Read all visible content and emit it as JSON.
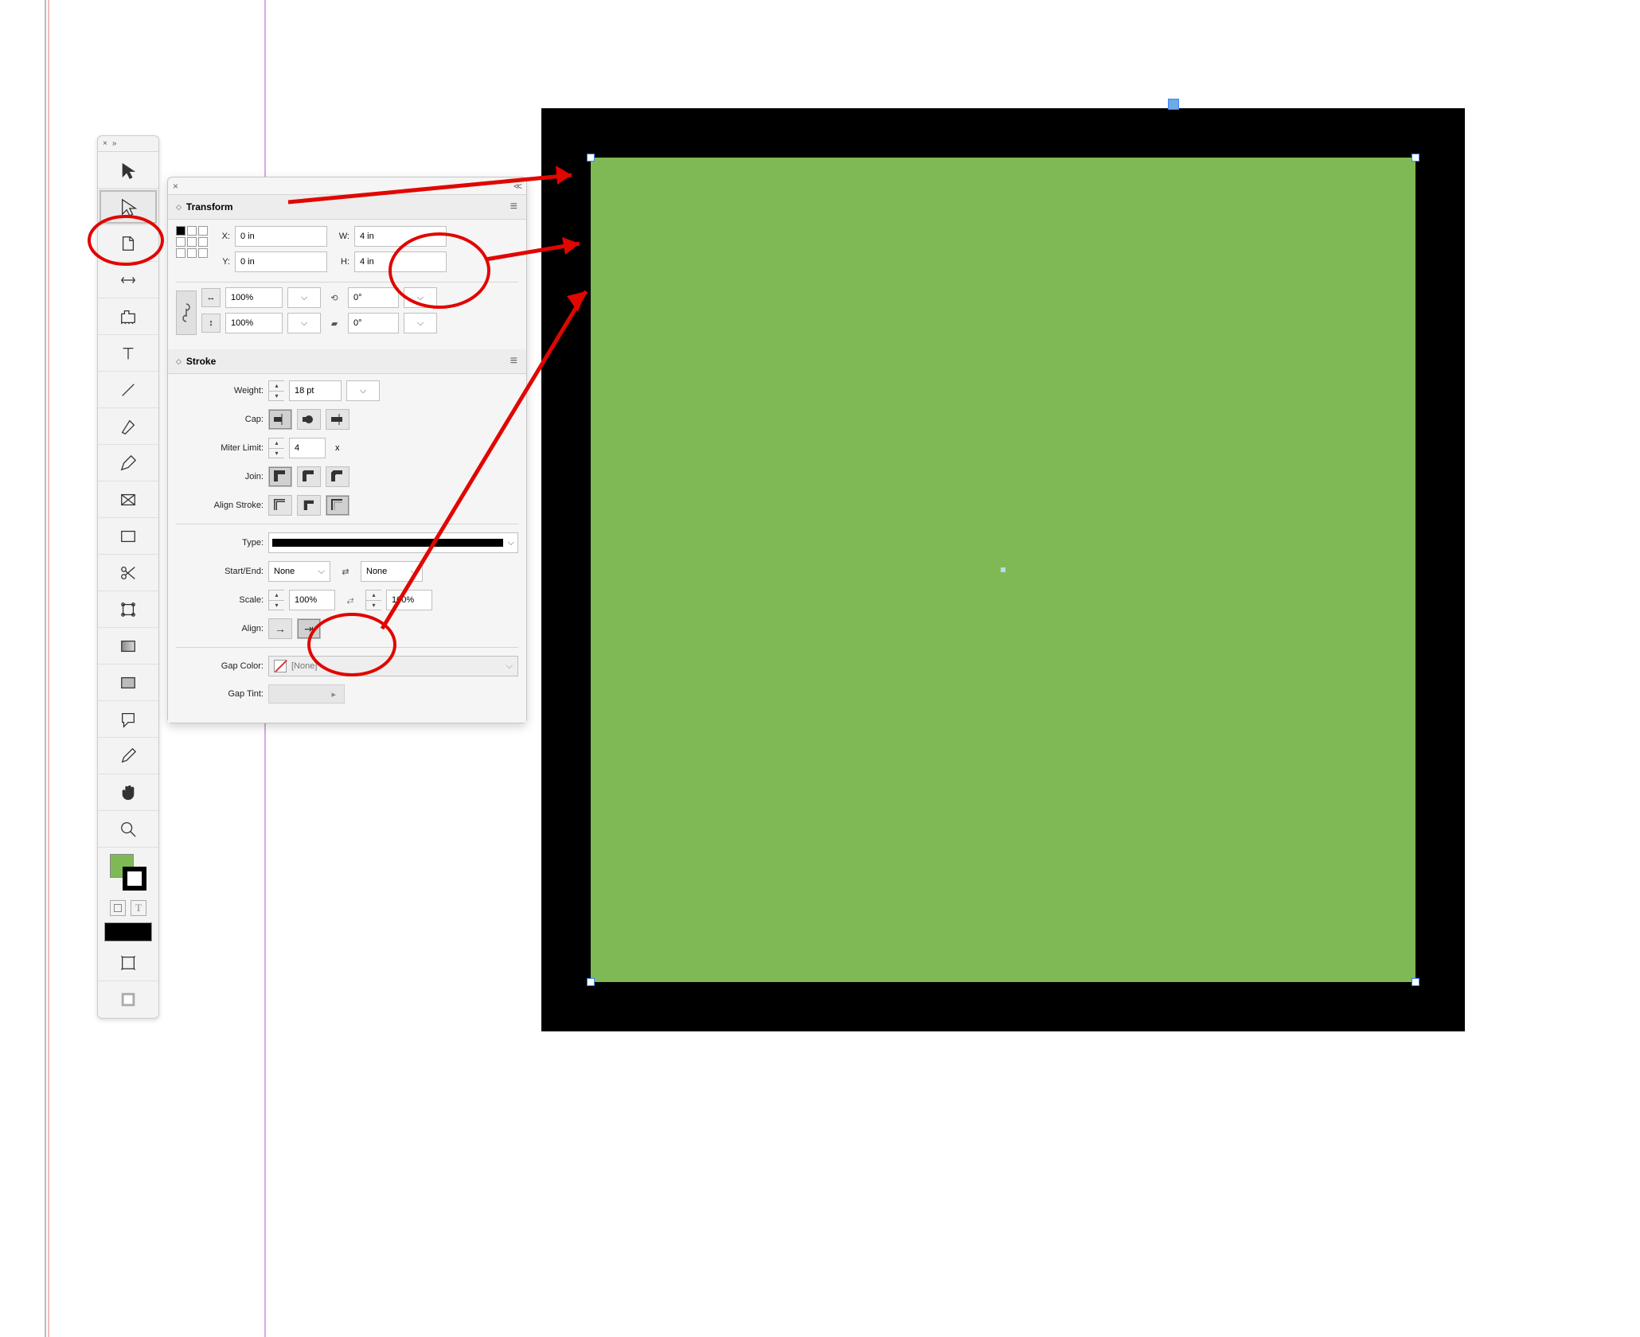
{
  "panel": {
    "transform": {
      "title": "Transform",
      "x_label": "X:",
      "y_label": "Y:",
      "w_label": "W:",
      "h_label": "H:",
      "x": "0 in",
      "y": "0 in",
      "w": "4 in",
      "h": "4 in",
      "scale_x": "100%",
      "scale_y": "100%",
      "rotate": "0°",
      "shear": "0°"
    },
    "stroke": {
      "title": "Stroke",
      "weight_label": "Weight:",
      "weight": "18 pt",
      "cap_label": "Cap:",
      "miter_label": "Miter Limit:",
      "miter": "4",
      "miter_x": "x",
      "join_label": "Join:",
      "align_label": "Align Stroke:",
      "type_label": "Type:",
      "startend_label": "Start/End:",
      "start": "None",
      "end": "None",
      "scale_label": "Scale:",
      "scale_start": "100%",
      "scale_end": "100%",
      "align2_label": "Align:",
      "gap_color_label": "Gap Color:",
      "gap_color": "[None]",
      "gap_tint_label": "Gap Tint:"
    }
  },
  "tools": {
    "close": "×",
    "expand": "»"
  },
  "colors": {
    "fill": "#7fb955",
    "stroke": "#000000",
    "accent": "#e10600"
  },
  "shape": {
    "fill": "#7fb955",
    "stroke": "#000000",
    "stroke_width_px": 62
  }
}
